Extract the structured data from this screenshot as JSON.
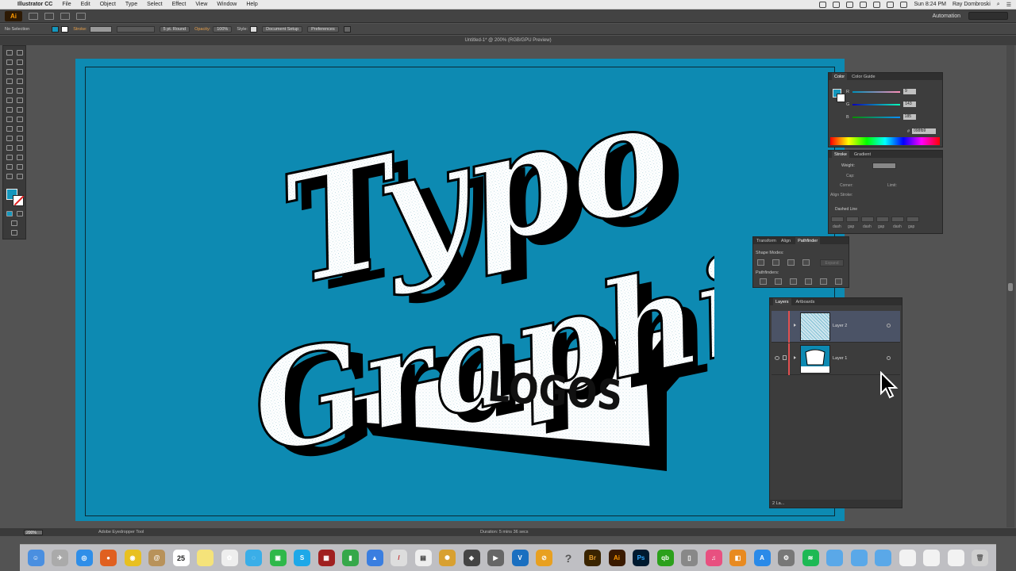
{
  "menubar": {
    "app": "Illustrator CC",
    "items": [
      "File",
      "Edit",
      "Object",
      "Type",
      "Select",
      "Effect",
      "View",
      "Window",
      "Help"
    ],
    "clock": "Sun 8:24 PM",
    "user": "Ray Dombroski"
  },
  "appbar": {
    "logo": "Ai",
    "workspace": "Automation",
    "search_placeholder": ""
  },
  "controlbar": {
    "selection": "No Selection",
    "stroke_label": "Stroke:",
    "brush": "5 pt. Round",
    "opacity_label": "Opacity:",
    "opacity_value": "100%",
    "style_label": "Style:",
    "doc_setup": "Document Setup",
    "preferences": "Preferences"
  },
  "document": {
    "tab_title": "Untitled-1* @ 200% (RGB/GPU Preview)"
  },
  "colors": {
    "artboard": "#0d8ab2",
    "fill": "#1597bd"
  },
  "color_panel": {
    "tabs": [
      "Color",
      "Color Guide"
    ],
    "r_label": "R",
    "g_label": "G",
    "b_label": "B",
    "r": "9",
    "g": "143",
    "b": "185",
    "hex_label": "#",
    "hex": "098fb9"
  },
  "stroke_panel": {
    "tabs": [
      "Stroke",
      "Gradient"
    ],
    "weight_label": "Weight:",
    "cap_label": "Cap:",
    "corner_label": "Corner:",
    "limit_label": "Limit:",
    "align_label": "Align Stroke:",
    "dashed_label": "Dashed Line",
    "dash_labels": [
      "dash",
      "gap",
      "dash",
      "gap",
      "dash",
      "gap"
    ]
  },
  "pathfinder_panel": {
    "tabs": [
      "Transform",
      "Align",
      "Pathfinder"
    ],
    "shape_modes": "Shape Modes:",
    "expand": "Expand",
    "pathfinders": "Pathfinders:"
  },
  "layers_panel": {
    "tabs": [
      "Layers",
      "Artboards"
    ],
    "layers": [
      {
        "name": "Layer 2"
      },
      {
        "name": "Layer 1"
      }
    ],
    "footer": "2 La..."
  },
  "artwork": {
    "line1": "Typo",
    "line2": "Graphic",
    "line3": "LOGOS"
  },
  "status": {
    "zoom": "200%",
    "tool": "Adobe Eyedropper Tool",
    "duration": "Duration: 5 mins 36 secs"
  },
  "dock": {
    "calendar_day": "25",
    "apps": [
      "finder",
      "launchpad",
      "safari",
      "firefox",
      "chrome",
      "contacts",
      "calendar",
      "notes",
      "photos",
      "messages",
      "facetime",
      "skype",
      "photo-booth",
      "numbers",
      "keynote",
      "textedit",
      "preview",
      "pixelmator",
      "pages",
      "itunes",
      "quicktime",
      "vivaldi",
      "screenflow",
      "help",
      "bridge",
      "illustrator",
      "photoshop",
      "quickbooks",
      "scanner",
      "music",
      "books",
      "app-store",
      "system-preferences",
      "spotify",
      "folder",
      "folder",
      "folder",
      "document",
      "document",
      "document",
      "trash"
    ]
  }
}
